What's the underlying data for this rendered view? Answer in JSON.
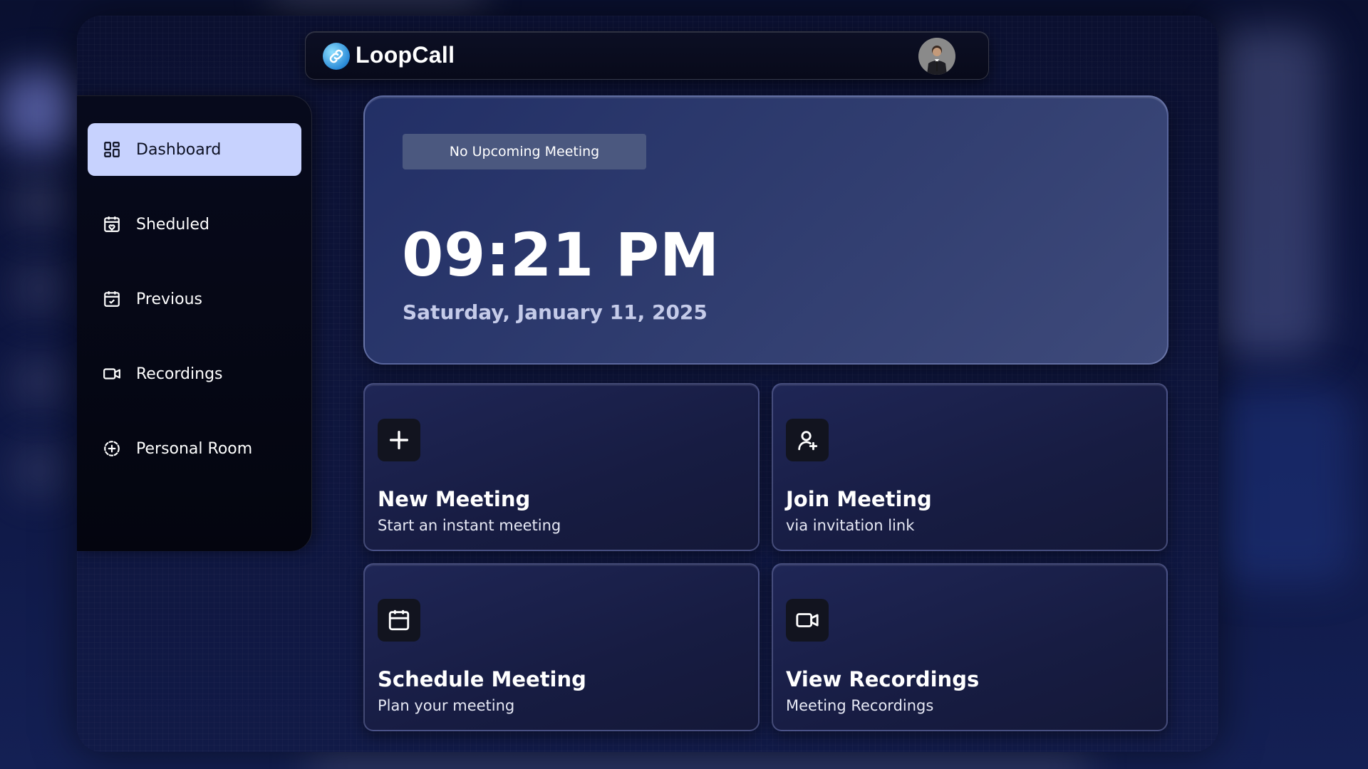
{
  "app": {
    "title": "LoopCall"
  },
  "header": {
    "avatar_icon": "user-avatar"
  },
  "sidebar": {
    "items": [
      {
        "label": "Dashboard",
        "icon": "dashboard-grid-icon",
        "active": true
      },
      {
        "label": "Sheduled",
        "icon": "calendar-heart-icon",
        "active": false
      },
      {
        "label": "Previous",
        "icon": "calendar-check-icon",
        "active": false
      },
      {
        "label": "Recordings",
        "icon": "video-icon",
        "active": false
      },
      {
        "label": "Personal Room",
        "icon": "add-circle-icon",
        "active": false
      }
    ]
  },
  "hero": {
    "badge": "No Upcoming Meeting",
    "time": "09:21 PM",
    "date": "Saturday, January 11, 2025"
  },
  "cards": [
    {
      "title": "New Meeting",
      "subtitle": "Start an instant meeting",
      "icon": "plus-icon"
    },
    {
      "title": "Join Meeting",
      "subtitle": "via invitation link",
      "icon": "user-add-icon"
    },
    {
      "title": "Schedule Meeting",
      "subtitle": "Plan your meeting",
      "icon": "calendar-icon"
    },
    {
      "title": "View Recordings",
      "subtitle": "Meeting Recordings",
      "icon": "video-icon"
    }
  ],
  "colors": {
    "active_nav_bg": "#c7d2fe",
    "hero_bg": "#2e3b6e",
    "card_bg": "#1f2656",
    "badge_bg": "#4b587f"
  }
}
